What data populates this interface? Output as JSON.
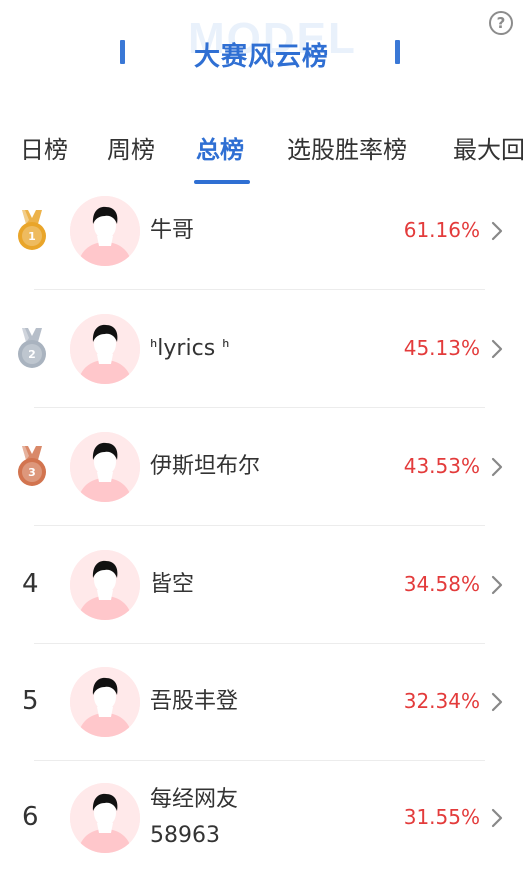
{
  "header": {
    "watermark": "MODEL",
    "title": "大赛风云榜",
    "help_symbol": "?"
  },
  "tabs": [
    {
      "label": "日榜",
      "active": false
    },
    {
      "label": "周榜",
      "active": false
    },
    {
      "label": "总榜",
      "active": true
    },
    {
      "label": "选股胜率榜",
      "active": false
    },
    {
      "label": "最大回",
      "active": false
    }
  ],
  "rows": [
    {
      "rank": "1",
      "medal": "gold",
      "name": "牛哥",
      "percent": "61.16%"
    },
    {
      "rank": "2",
      "medal": "silver",
      "name": "ᑋlyrics ᑋ",
      "percent": "45.13%"
    },
    {
      "rank": "3",
      "medal": "bronze",
      "name": "伊斯坦布尔",
      "percent": "43.53%"
    },
    {
      "rank": "4",
      "medal": "",
      "name": "皆空",
      "percent": "34.58%"
    },
    {
      "rank": "5",
      "medal": "",
      "name": "吾股丰登",
      "percent": "32.34%"
    },
    {
      "rank": "6",
      "medal": "",
      "name": "每经网友\n58963",
      "percent": "31.55%"
    }
  ],
  "colors": {
    "accent": "#2f6fd3",
    "percent": "#e33b3b",
    "gold": "#e9a52a",
    "silver": "#a9b3bf",
    "bronze": "#d2744f"
  }
}
